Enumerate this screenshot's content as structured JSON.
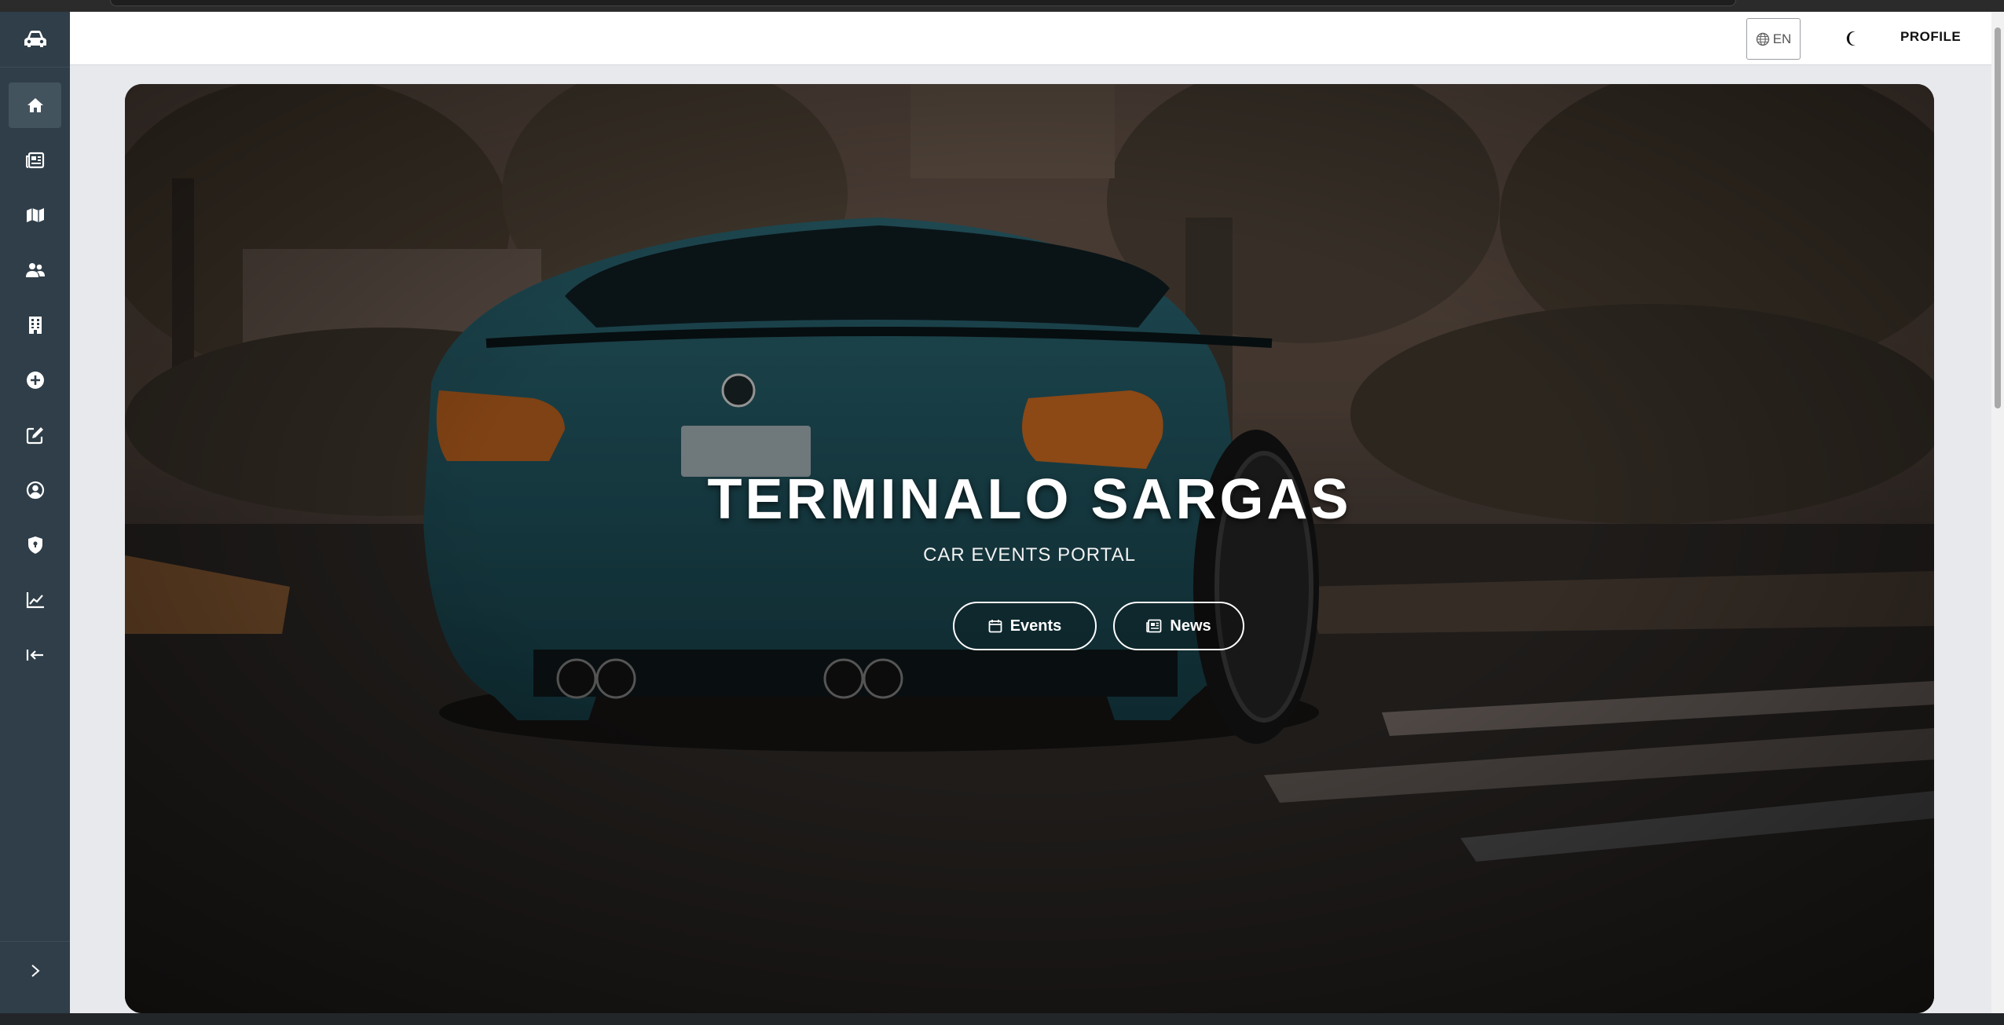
{
  "sidebar": {
    "logo_icon": "car-icon",
    "items": [
      {
        "icon": "home-icon",
        "active": true
      },
      {
        "icon": "newspaper-icon",
        "active": false
      },
      {
        "icon": "map-icon",
        "active": false
      },
      {
        "icon": "users-icon",
        "active": false
      },
      {
        "icon": "building-icon",
        "active": false
      },
      {
        "icon": "add-circle-icon",
        "active": false
      },
      {
        "icon": "edit-icon",
        "active": false
      },
      {
        "icon": "user-circle-icon",
        "active": false
      },
      {
        "icon": "shield-icon",
        "active": false
      },
      {
        "icon": "chart-line-icon",
        "active": false
      },
      {
        "icon": "logout-icon",
        "active": false
      }
    ],
    "expand_icon": "chevron-right-icon"
  },
  "topbar": {
    "language_label": "EN",
    "theme_icon": "moon-icon",
    "profile_label": "PROFILE"
  },
  "hero": {
    "title": "TERMINALO SARGAS",
    "subtitle": "CAR EVENTS PORTAL",
    "events_label": "Events",
    "news_label": "News"
  },
  "colors": {
    "sidebar_bg": "#2f3e48",
    "sidebar_active": "#43535e",
    "page_bg": "#e8e9ec",
    "car_teal": "#1f5866"
  }
}
